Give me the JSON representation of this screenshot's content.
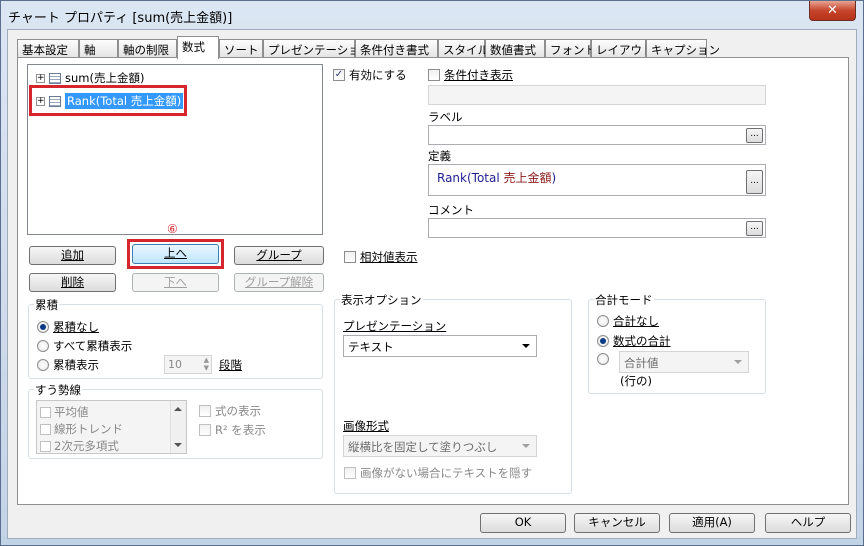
{
  "window": {
    "title": "チャート プロパティ [sum(売上金額)]",
    "close_glyph": "✕"
  },
  "tabs": [
    {
      "label": "基本設定"
    },
    {
      "label": "軸"
    },
    {
      "label": "軸の制限"
    },
    {
      "label": "数式"
    },
    {
      "label": "ソート"
    },
    {
      "label": "プレゼンテーション"
    },
    {
      "label": "条件付き書式"
    },
    {
      "label": "スタイル"
    },
    {
      "label": "数値書式"
    },
    {
      "label": "フォント"
    },
    {
      "label": "レイアウト"
    },
    {
      "label": "キャプション"
    }
  ],
  "active_tab": "数式",
  "tree": {
    "items": [
      {
        "label": "sum(売上金額)",
        "selected": false
      },
      {
        "label": "Rank(Total 売上金額)",
        "selected": true
      }
    ]
  },
  "annotation": {
    "marker": "⑥"
  },
  "buttons": {
    "add": "追加",
    "up": "上へ",
    "group": "グループ",
    "delete": "削除",
    "down": "下へ",
    "ungroup": "グループ解除",
    "dots": "..."
  },
  "accumulation": {
    "title": "累積",
    "options": [
      "累積なし",
      "すべて累積表示",
      "累積表示"
    ],
    "selected": "累積なし",
    "steps_value": "10",
    "steps_label": "段階"
  },
  "trendlines": {
    "title": "すう勢線",
    "items": [
      "平均値",
      "線形トレンド",
      "2次元多項式"
    ],
    "show_formula": "式の表示",
    "show_r2": "R² を表示"
  },
  "right": {
    "enabled_label": "有効にする",
    "enabled": true,
    "conditional_label": "条件付き表示",
    "label_caption": "ラベル",
    "label_value": "",
    "definition_caption": "定義",
    "definition_func": "Rank(Total ",
    "definition_field": "売上金額",
    "definition_close": ")",
    "comment_caption": "コメント",
    "relative_label": "相対値表示"
  },
  "display_options": {
    "title": "表示オプション",
    "presentation_caption": "プレゼンテーション",
    "presentation_value": "テキスト",
    "image_format_caption": "画像形式",
    "image_format_value": "縦横比を固定して塗りつぶし",
    "hide_text_label": "画像がない場合にテキストを隠す"
  },
  "total_mode": {
    "title": "合計モード",
    "options": [
      "合計なし",
      "数式の合計"
    ],
    "selected": "数式の合計",
    "sum_of_value": "合計値",
    "rows_of": "(行の)"
  },
  "footer": {
    "ok": "OK",
    "cancel": "キャンセル",
    "apply": "適用(A)",
    "help": "ヘルプ"
  },
  "colors": {
    "selection": "#3399ff",
    "highlight_box": "#d6262d",
    "field_name": "#8b1a1a",
    "func_name": "#1f1f8f"
  }
}
